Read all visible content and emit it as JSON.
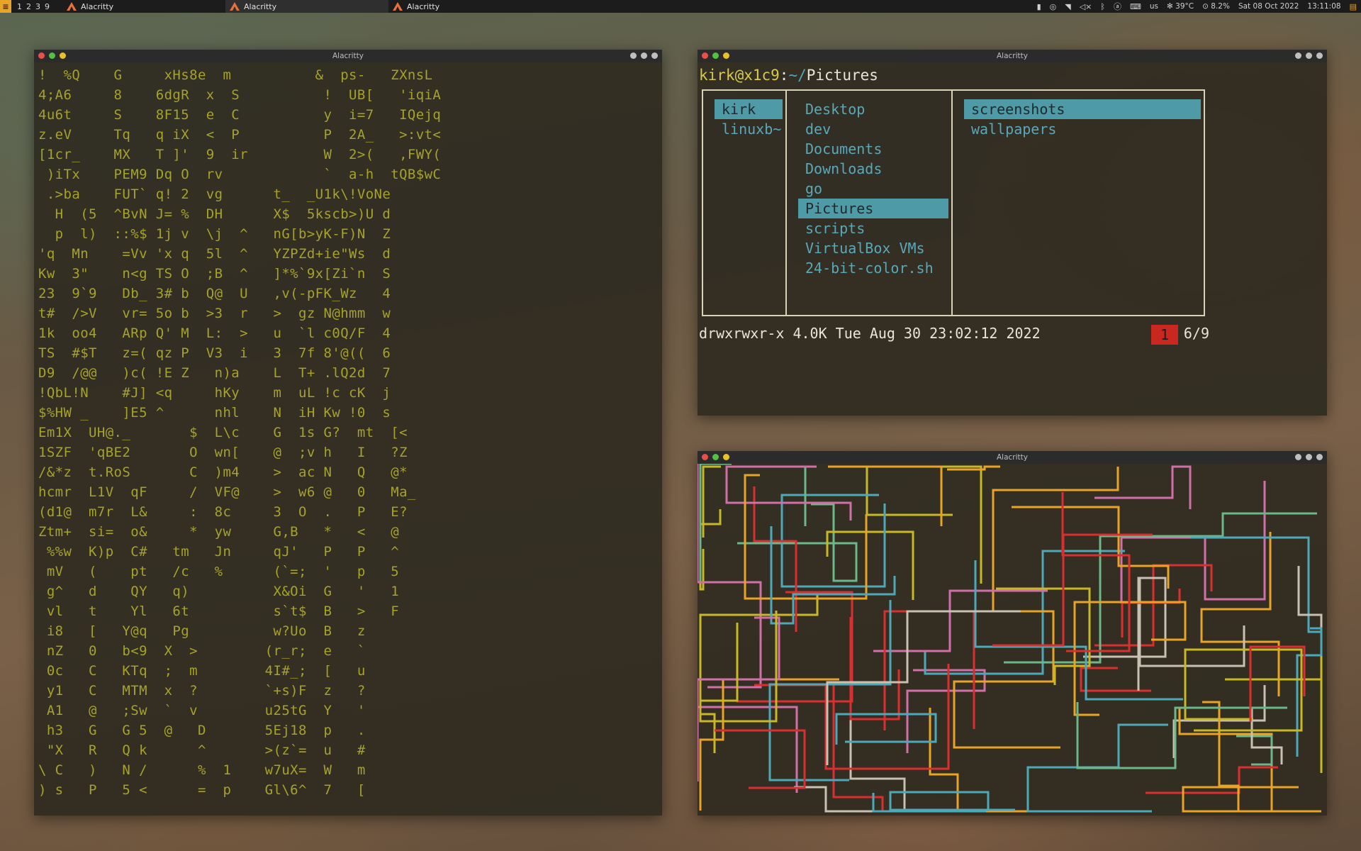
{
  "topbar": {
    "logo": "≡",
    "workspaces": [
      "1",
      "2",
      "3",
      "9"
    ],
    "tasks": [
      {
        "label": "Alacritty",
        "active": false
      },
      {
        "label": "Alacritty",
        "active": true
      },
      {
        "label": "Alacritty",
        "active": false
      }
    ],
    "tray": {
      "battery_glyph": "▮",
      "keyboard": "us",
      "temperature": "39°C",
      "cpu": "8.2%",
      "date": "Sat 08 Oct 2022",
      "time": "13:11:08"
    }
  },
  "windows": {
    "matrix": {
      "title": "Alacritty",
      "rows": [
        "!  %Q    G     xHs8e  m          &  ps-   ZXnsL",
        "4;A6     8    6dgR  x  S          !  UB[   'iqiA",
        "4u6t     S    8F15  e  C          y  i=7   IQejq",
        "z.eV     Tq   q iX  <  P          P  2A_   >:vt<",
        "[1cr_    MX   T ]'  9  ir         W  2>(   ,FWY(",
        " )iTx    PEM9 Dq O  rv            `  a-h  tQB$wC",
        " .>ba    FUT` q! 2  vg      t_  _U1k\\!VoNe",
        "  H  (5  ^BvN J= %  DH      X$  5kscb>)U d",
        "  p  l)  ::%$ 1j v  \\j  ^   nG[b>yK-F)N  Z",
        "'q  Mn    =Vv 'x q  5l  ^   YZPZd+ie\"Ws  d",
        "Kw  3\"    n<g TS O  ;B  ^   ]*%`9x[Zi`n  S",
        "23  9`9   Db_ 3# b  Q@  U   ,v(-pFK_Wz   4",
        "t#  />V   vr= 5o b  >3  r   >  gz N@hmm  w",
        "1k  oo4   ARp Q' M  L:  >   u  `l c0Q/F  4",
        "TS  #$T   z=( qz P  V3  i   3  7f 8'@((  6",
        "D9  /@@   )c( !E Z   n)a    L  T+ .lQ2d  7",
        "!QbL!N    #J] <q     hKy    m  uL !c cK  j",
        "$%HW _    ]E5 ^      nhl    N  iH Kw !0  s",
        "Em1X  UH@._       $  L\\c    G  1s G?  mt  [<",
        "1SZF  'qBE2       O  wn[    @  ;v h   I   ?Z",
        "/&*z  t.RoS       C  )m4    >  ac N   Q   @*",
        "hcmr  L1V  qF     /  VF@    >  w6 @   0   Ma_",
        "(d1@  m7r  L&     :  8c     3  O  .   P   E?",
        "Ztm+  si=  o&     *  yw     G,B   *   <   @",
        " %%w  K)p  C#   tm   Jn     qJ'   P   P   ^",
        " mV   (    pt   /c   %      (`=;  '   p   5",
        " g^   d    QY   q)          X&Oi  G   '   1",
        " vl   t    Yl   6t          s`t$  B   >   F",
        " i8   [   Y@q   Pg          w?Uo  B   z",
        " nZ   0   b<9  X  >        (r_r;  e   `",
        " 0c   C   KTq  ;  m        4I#_;  [   u",
        " y1   C   MTM  x  ?        `+s)F  z   ?",
        " A1   @   ;Sw  `  v        u25tG  Y   '",
        " h3   G   G 5  @   D       5Ej18  p   .",
        " \"X   R   Q k      ^       >(z`=  u   #",
        "\\ C   )   N /      %  1    w7uX=  W   m",
        ") s   P   5 <      =  p    Gl\\6^  7   ["
      ]
    },
    "ranger": {
      "title": "Alacritty",
      "prompt": {
        "user_host": "kirk@x1c9",
        "sep": ":",
        "path_prefix": "~/",
        "path_dir": "Pictures"
      },
      "col1": [
        "kirk",
        "linuxb~"
      ],
      "col1_selected": 0,
      "col2": [
        "Desktop",
        "dev",
        "Documents",
        "Downloads",
        "go",
        "Pictures",
        "scripts",
        "VirtualBox VMs",
        "24-bit-color.sh"
      ],
      "col2_selected": 5,
      "col3": [
        "screenshots",
        "wallpapers"
      ],
      "col3_selected": 0,
      "status": {
        "info": "drwxrwxr-x 4.0K Tue Aug 30 23:02:12 2022",
        "badge": "1",
        "count": "6/9"
      }
    },
    "pipes": {
      "title": "Alacritty"
    }
  },
  "colors": {
    "matrix_text": "#a6a22a",
    "ranger_accent": "#4e9aa6",
    "badge_red": "#c8281f",
    "pipe_palette": [
      "#c8b828",
      "#4fa8b8",
      "#d070a8",
      "#d83030",
      "#e8a428",
      "#6cb88a",
      "#c8c0b0"
    ]
  }
}
